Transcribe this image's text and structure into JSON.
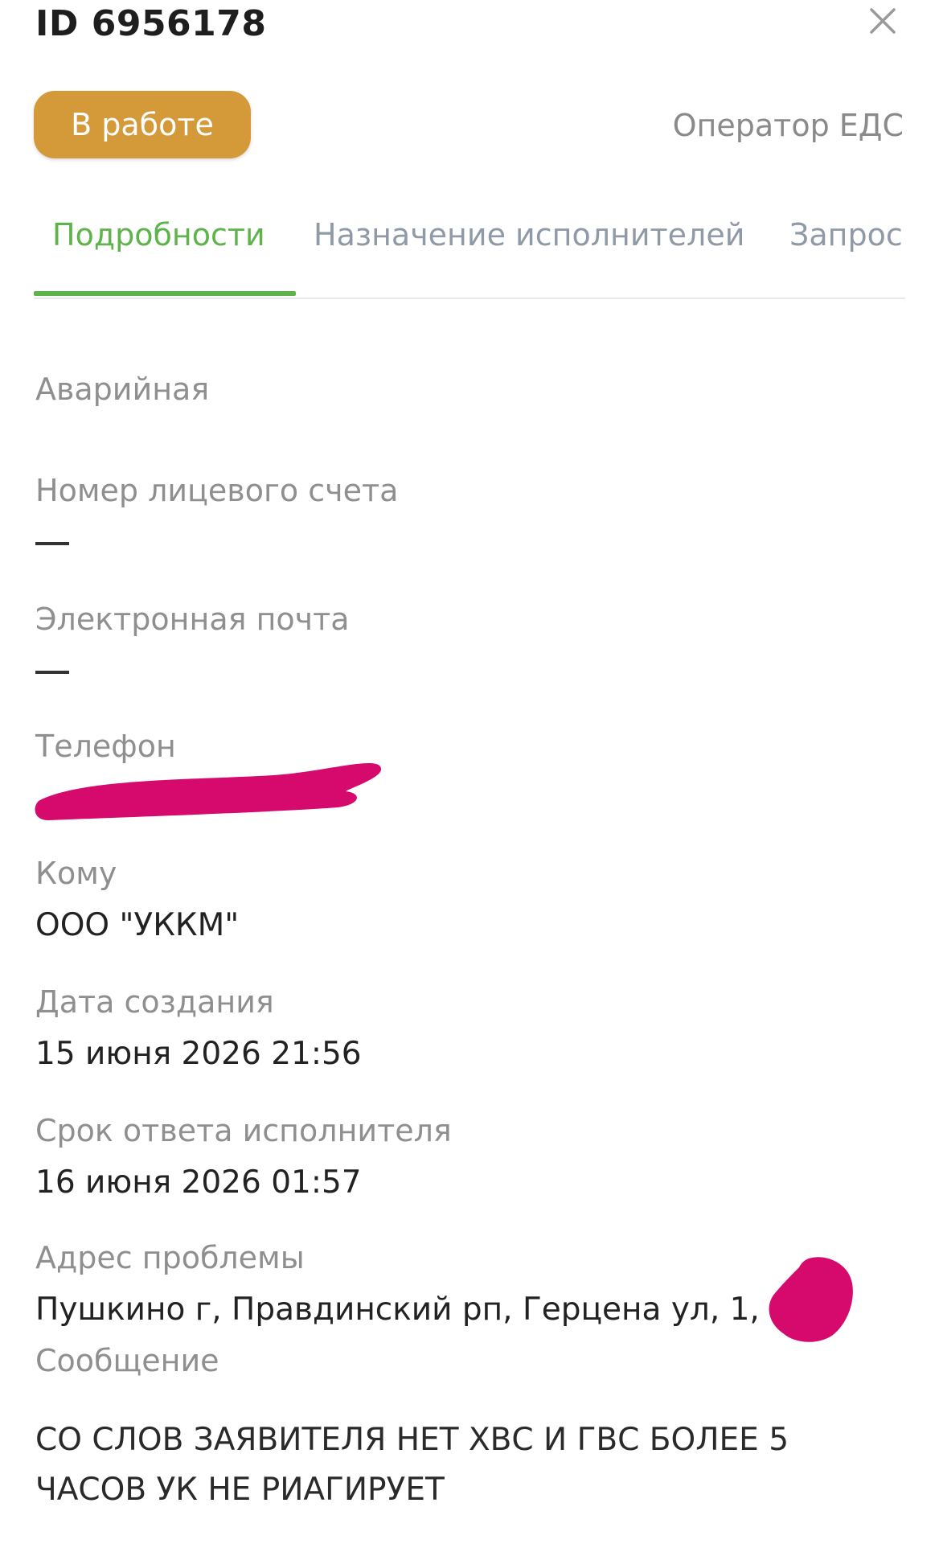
{
  "header": {
    "title": "ID 6956178",
    "close_icon": "close-icon"
  },
  "status": {
    "label": "В работе",
    "color": "#d49a3a",
    "operator": "Оператор ЕДС"
  },
  "tabs": [
    {
      "label": "Подробности",
      "active": true
    },
    {
      "label": "Назначение исполнителей",
      "active": false
    },
    {
      "label": "Запрос",
      "active": false
    }
  ],
  "details": {
    "category": "Аварийная",
    "account_label": "Номер лицевого счета",
    "account_value": "—",
    "email_label": "Электронная почта",
    "email_value": "—",
    "phone_label": "Телефон",
    "to_label": "Кому",
    "to_value": "ООО \"УККМ\"",
    "created_label": "Дата создания",
    "created_value": "15 июня 2026 21:56",
    "deadline_label": "Срок ответа исполнителя",
    "deadline_value": "16 июня 2026 01:57",
    "address_label": "Адрес проблемы",
    "address_value": "Пушкино г, Правдинский рп, Герцена ул, 1, кв",
    "message_label": "Сообщение",
    "message_value": "СО СЛОВ ЗАЯВИТЕЛЯ НЕТ ХВС И ГВС БОЛЕЕ 5 ЧАСОВ УК НЕ РИАГИРУЕТ"
  },
  "colors": {
    "accent": "#5eb34b",
    "redaction": "#d60a6c"
  }
}
